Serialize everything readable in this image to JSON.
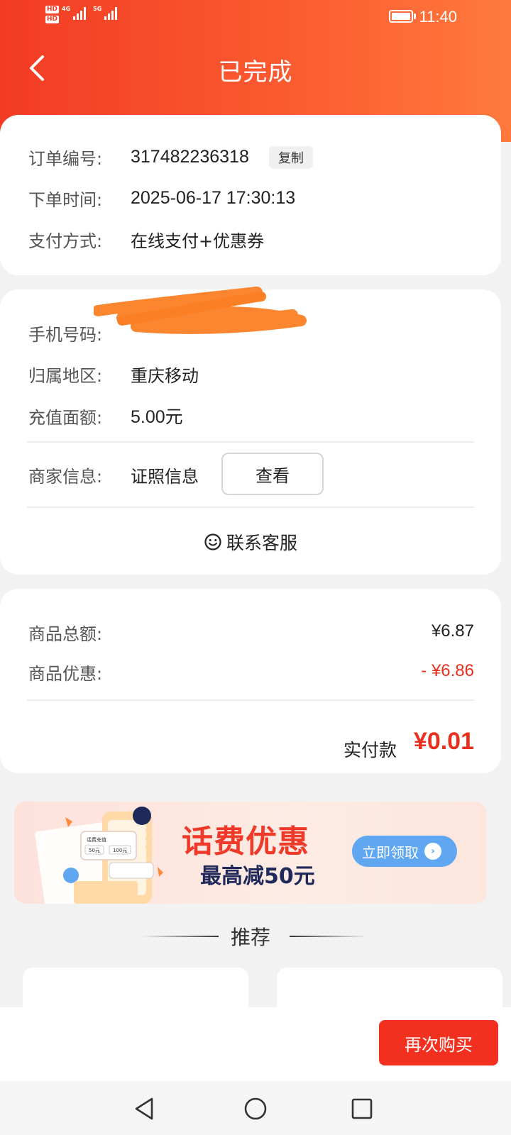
{
  "status_bar": {
    "hd1": "HD",
    "hd2": "HD",
    "net1": "4G",
    "net2": "5G",
    "time": "11:40"
  },
  "header": {
    "title": "已完成"
  },
  "order": {
    "number_label": "订单编号:",
    "number": "317482236318",
    "copy_label": "复制",
    "time_label": "下单时间:",
    "time": "2025-06-17 17:30:13",
    "pay_method_label": "支付方式:",
    "pay_method": "在线支付+优惠券"
  },
  "recharge": {
    "phone_label": "手机号码:",
    "region_label": "归属地区:",
    "region": "重庆移动",
    "amount_label": "充值面额:",
    "amount": "5.00元",
    "merchant_label": "商家信息:",
    "merchant_value": "证照信息",
    "view_label": "查看",
    "contact_label": "联系客服"
  },
  "payment": {
    "total_label": "商品总额:",
    "total": "¥6.87",
    "discount_label": "商品优惠:",
    "discount": "- ¥6.86",
    "paid_label": "实付款",
    "paid": "¥0.01"
  },
  "banner": {
    "title": "话费优惠",
    "subtitle": "最高减50元",
    "button": "立即领取",
    "card_title": "话费充值",
    "card_opt1": "50元",
    "card_opt2": "100元"
  },
  "recommend": {
    "title": "推荐"
  },
  "bottom": {
    "buy_again": "再次购买"
  },
  "colors": {
    "accent": "#f2301f",
    "header_start": "#f23b24",
    "header_end": "#ff7a3c",
    "banner_button": "#5fa7f0",
    "discount_red": "#e8301f"
  }
}
